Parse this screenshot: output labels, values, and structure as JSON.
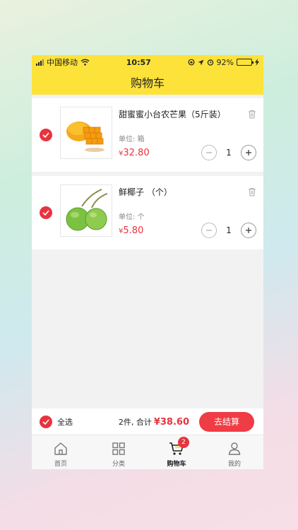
{
  "status": {
    "carrier": "中国移动",
    "time": "10:57",
    "battery": "92%"
  },
  "header": {
    "title": "购物车"
  },
  "cart": {
    "items": [
      {
        "name": "甜蜜蜜小台农芒果（5斤装）",
        "unit": "单位: 箱",
        "currency": "¥",
        "price": "32.80",
        "qty": "1",
        "checked": true
      },
      {
        "name": "鲜椰子 （个）",
        "unit": "单位: 个",
        "currency": "¥",
        "price": "5.80",
        "qty": "1",
        "checked": true
      }
    ]
  },
  "footer": {
    "select_all": "全选",
    "summary": "2件, 合计",
    "total_currency": "¥",
    "total": "38.60",
    "checkout": "去结算"
  },
  "tabs": [
    {
      "label": "首页",
      "icon": "home-icon"
    },
    {
      "label": "分类",
      "icon": "grid-icon"
    },
    {
      "label": "购物车",
      "icon": "cart-icon",
      "badge": "2",
      "active": true
    },
    {
      "label": "我的",
      "icon": "user-icon"
    }
  ],
  "colors": {
    "brand": "#fde23a",
    "accent": "#e8343f"
  }
}
